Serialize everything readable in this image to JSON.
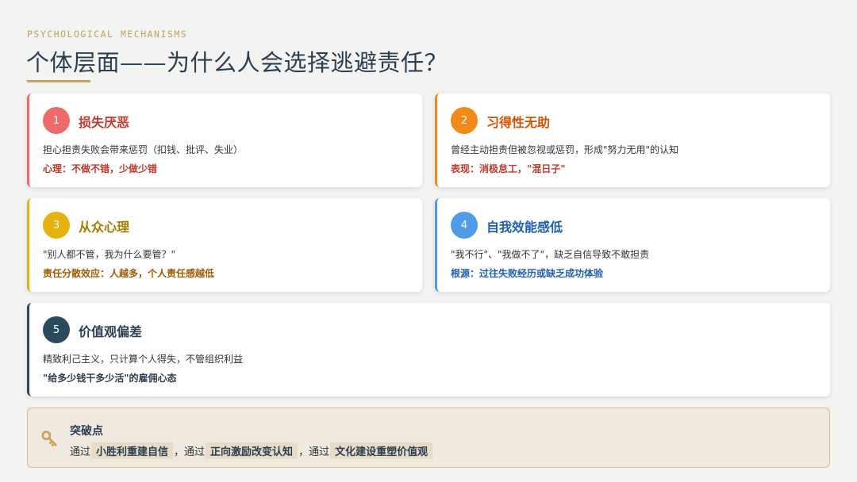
{
  "header": {
    "eyebrow": "PSYCHOLOGICAL MECHANISMS",
    "title": "个体层面——为什么人会选择逃避责任？"
  },
  "cards": [
    {
      "number": "1",
      "title": "损失厌恶",
      "desc": "担心担责失败会带来惩罚（扣钱、批评、失业）",
      "note": "心理：不做不错，少做少错",
      "accent": "#f06a6a",
      "title_color": "#c0392b",
      "note_color": "#c0392b"
    },
    {
      "number": "2",
      "title": "习得性无助",
      "desc": "曾经主动担责但被忽视或惩罚，形成\"努力无用\"的认知",
      "note": "表现：消极怠工，\"混日子\"",
      "accent": "#f28a1a",
      "title_color": "#d35400",
      "note_color": "#c0392b"
    },
    {
      "number": "3",
      "title": "从众心理",
      "desc": "\"别人都不管，我为什么要管？\"",
      "note": "责任分散效应：人越多，个人责任感越低",
      "accent": "#e6b210",
      "title_color": "#a67c00",
      "note_color": "#a05a00"
    },
    {
      "number": "4",
      "title": "自我效能感低",
      "desc": "\"我不行\"、\"我做不了\"，缺乏自信导致不敢担责",
      "note": "根源：过往失败经历或缺乏成功体验",
      "accent": "#4f9be8",
      "title_color": "#1f5fb0",
      "note_color": "#1f5fb0"
    },
    {
      "number": "5",
      "title": "价值观偏差",
      "desc": "精致利己主义，只计算个人得失，不管组织利益",
      "note": "\"给多少钱干多少活\"的雇佣心态",
      "accent": "#2c4a5e",
      "title_color": "#2c3e50",
      "note_color": "#2c3e50"
    }
  ],
  "breakthrough": {
    "icon": "key-icon",
    "title": "突破点",
    "prefix1": "通过",
    "highlight1": "小胜利重建自信",
    "prefix2": "，通过",
    "highlight2": "正向激励改变认知",
    "prefix3": "，通过",
    "highlight3": "文化建设重塑价值观",
    "accent": "#d9bf8d"
  }
}
